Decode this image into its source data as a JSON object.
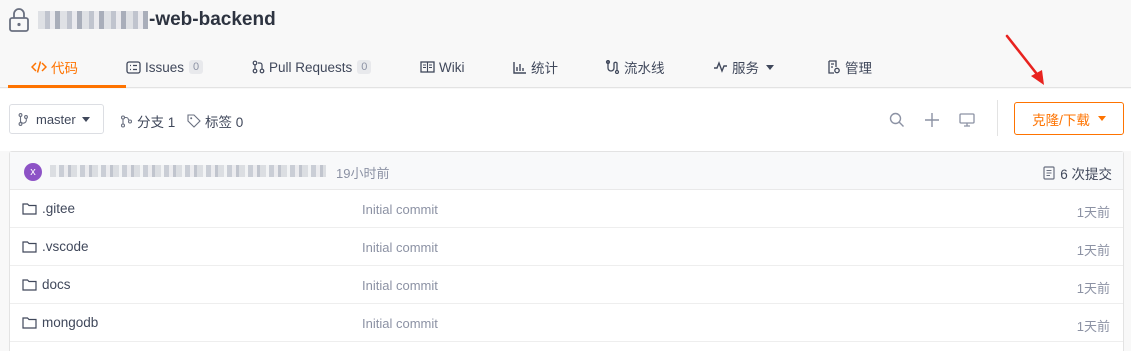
{
  "repo": {
    "name_suffix": "-web-backend"
  },
  "tabs": [
    {
      "label": "代码",
      "icon": "code-icon",
      "count": null
    },
    {
      "label": "Issues",
      "icon": "issues-icon",
      "count": "0"
    },
    {
      "label": "Pull Requests",
      "icon": "pull-request-icon",
      "count": "0"
    },
    {
      "label": "Wiki",
      "icon": "wiki-icon",
      "count": null
    },
    {
      "label": "统计",
      "icon": "stats-icon",
      "count": null
    },
    {
      "label": "流水线",
      "icon": "pipeline-icon",
      "count": null
    },
    {
      "label": "服务",
      "icon": "pulse-icon",
      "count": null
    },
    {
      "label": "管理",
      "icon": "manage-icon",
      "count": null
    }
  ],
  "toolbar": {
    "branch": "master",
    "branches_label": "分支 1",
    "tags_label": "标签 0",
    "clone_label": "克隆/下载"
  },
  "commit": {
    "avatar_letter": "x",
    "time": "19小时前",
    "count_label": "6 次提交"
  },
  "files": [
    {
      "name": ".gitee",
      "message": "Initial commit",
      "age": "1天前"
    },
    {
      "name": ".vscode",
      "message": "Initial commit",
      "age": "1天前"
    },
    {
      "name": "docs",
      "message": "Initial commit",
      "age": "1天前"
    },
    {
      "name": "mongodb",
      "message": "Initial commit",
      "age": "1天前"
    }
  ],
  "colors": {
    "accent": "#fe7300",
    "annotation_arrow": "#e8231f",
    "avatar": "#8d53c6"
  }
}
